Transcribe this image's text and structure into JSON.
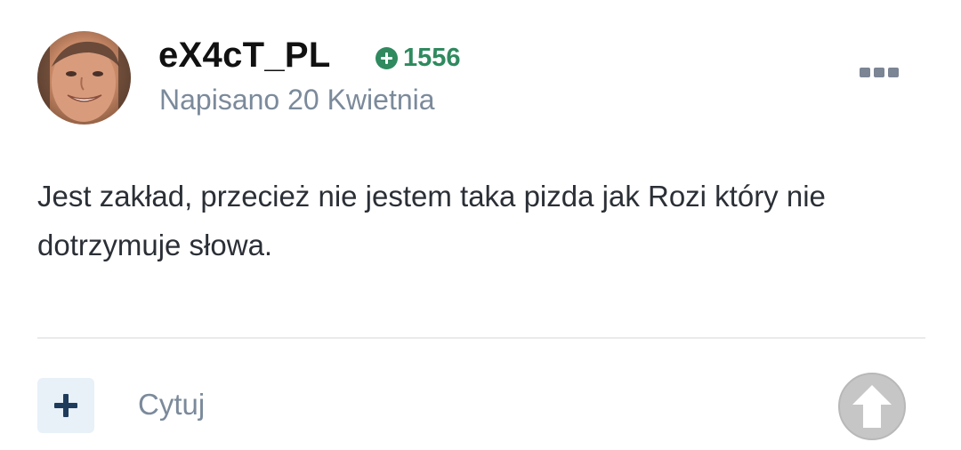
{
  "post": {
    "author": "eX4cT_PL",
    "reputation": "1556",
    "posted": "Napisano 20 Kwietnia",
    "body": "Jest zakład, przecież nie jestem taka pizda jak Rozi który nie dotrzymuje słowa."
  },
  "actions": {
    "quote_label": "Cytuj"
  },
  "icons": {
    "avatar": "avatar-photo",
    "reputation": "plus-circle-icon",
    "menu": "more-options-icon",
    "add": "plus-icon",
    "upvote": "arrow-up-icon"
  },
  "colors": {
    "reputation": "#2f8a5f",
    "meta_text": "#7b8a9b",
    "add_button_bg": "#e8f0f8",
    "add_button_icon": "#1f3b5c",
    "upvote_bg": "#c6c6c6"
  }
}
